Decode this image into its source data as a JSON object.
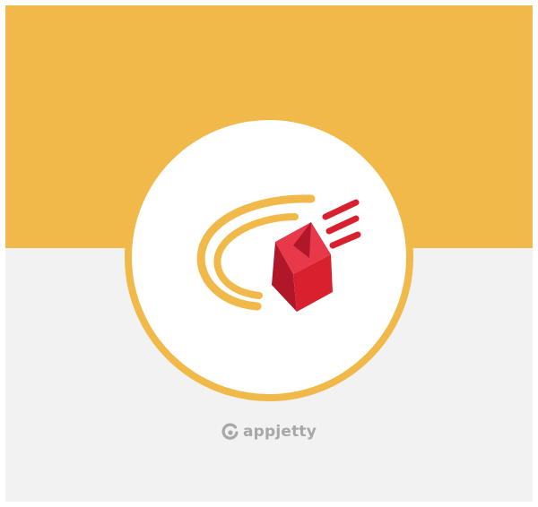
{
  "brand": {
    "name": "appjetty",
    "logo_icon": "appjetty-logo-icon"
  },
  "badge": {
    "icon": "shipping-box-delivery-icon"
  },
  "colors": {
    "top_band": "#f0b94a",
    "bottom_band": "#f2f2f2",
    "badge_ring": "#f0b94a",
    "badge_fill": "#ffffff",
    "swoosh": "#f0b94a",
    "box_dark": "#b0182a",
    "box_mid": "#d8202f",
    "box_light": "#e8394a",
    "brand_text": "#a7a7a7"
  }
}
